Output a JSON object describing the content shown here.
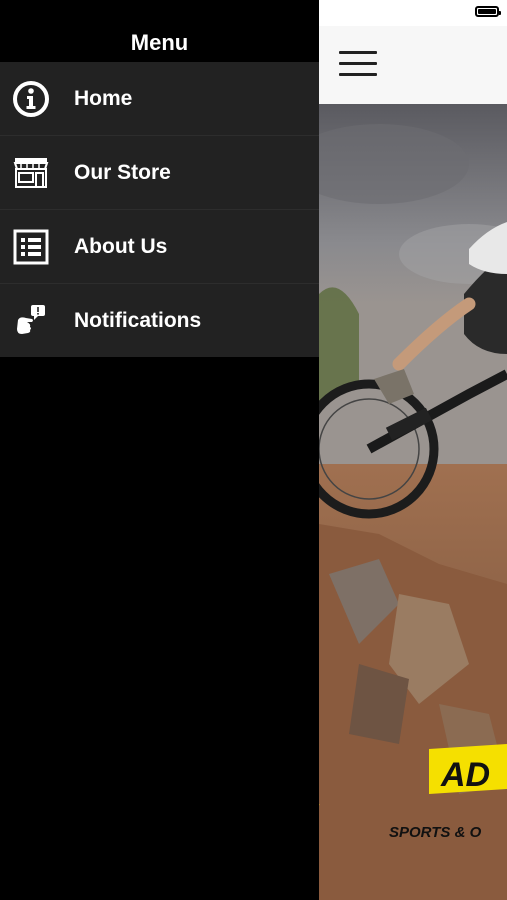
{
  "drawer": {
    "title": "Menu",
    "items": [
      {
        "label": "Home",
        "icon": "info-icon"
      },
      {
        "label": "Our Store",
        "icon": "store-icon"
      },
      {
        "label": "About Us",
        "icon": "list-icon"
      },
      {
        "label": "Notifications",
        "icon": "notification-hand-icon"
      }
    ]
  },
  "content": {
    "hero_logo_text": "AD",
    "hero_logo_subtext": "SPORTS & O"
  },
  "colors": {
    "drawer_bg": "#000000",
    "menu_item_bg": "#222222",
    "text": "#ffffff",
    "logo_yellow": "#f5e000"
  }
}
